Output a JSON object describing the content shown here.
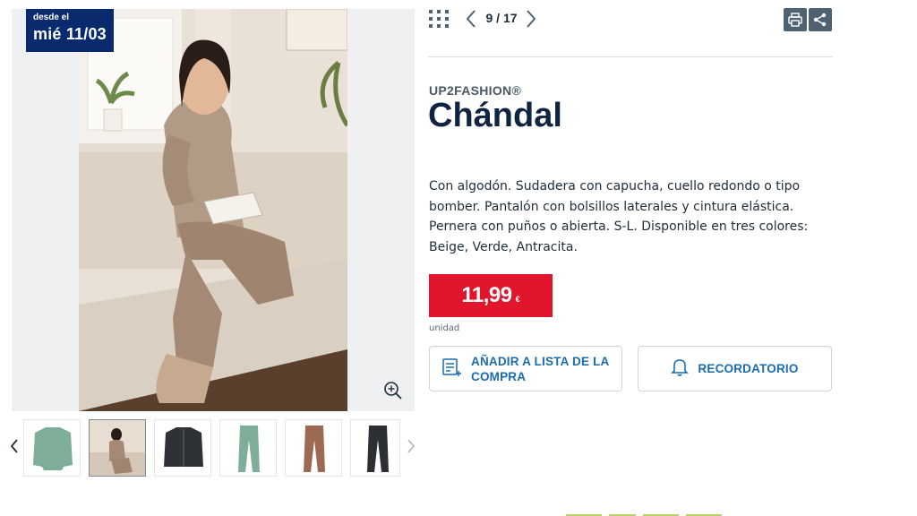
{
  "gallery": {
    "badge": {
      "line1": "desde el",
      "line2": "mié 11/03"
    },
    "thumbnails": [
      {
        "name": "thumb-green-sweatshirt"
      },
      {
        "name": "thumb-model-beige"
      },
      {
        "name": "thumb-black-jacket"
      },
      {
        "name": "thumb-green-pants"
      },
      {
        "name": "thumb-brown-pants"
      },
      {
        "name": "thumb-black-pants"
      }
    ],
    "active_index": 1
  },
  "toolbar": {
    "pager": "9 / 17"
  },
  "product": {
    "brand": "UP2FASHION®",
    "title": "Chándal",
    "description": "Con algodón. Sudadera con capucha, cuello redondo o tipo bomber. Pantalón con bolsillos laterales y cintura elástica. Pernera con puños o abierta. S-L. Disponible en tres colores: Beige, Verde, Antracita.",
    "price": "11,99",
    "currency": "€",
    "unit": "unidad"
  },
  "actions": {
    "shopping_list": "AÑADIR A LISTA DE LA COMPRA",
    "reminder": "RECORDATORIO"
  },
  "colors": {
    "price_bg": "#e1162c",
    "badge_bg": "#0a2a6e",
    "accent": "#1a6dad",
    "tool_bg": "#4f6272"
  }
}
